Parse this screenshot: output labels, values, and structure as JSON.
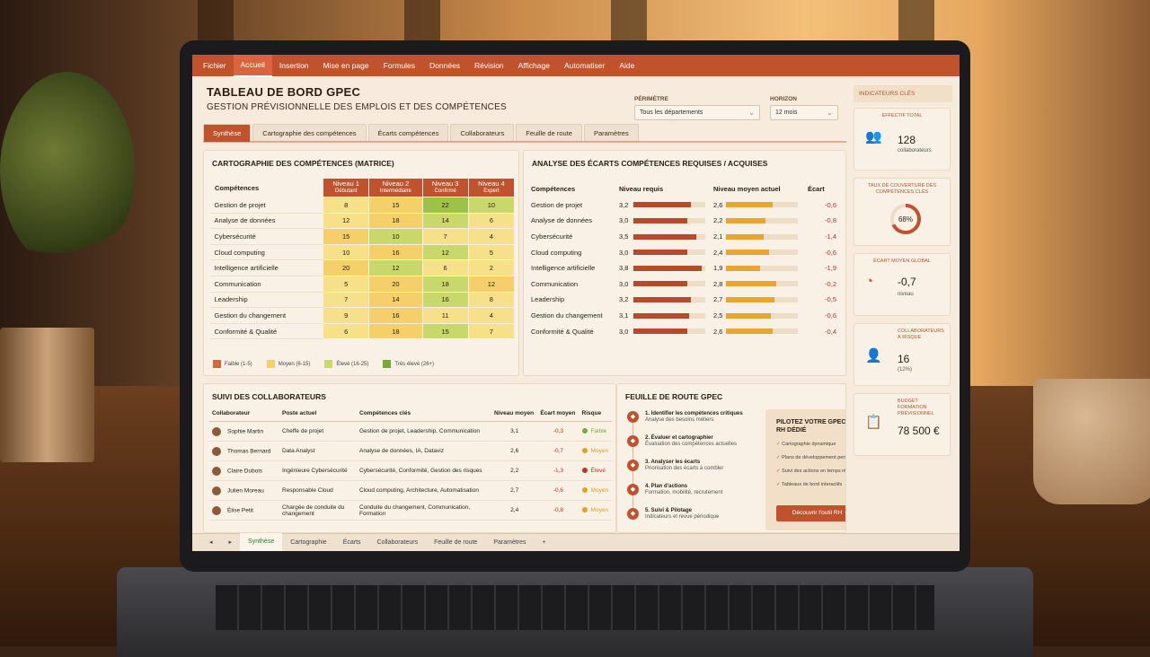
{
  "ribbon": [
    "Fichier",
    "Accueil",
    "Insertion",
    "Mise en page",
    "Formules",
    "Données",
    "Révision",
    "Affichage",
    "Automatiser",
    "Aide"
  ],
  "header": {
    "title": "TABLEAU DE BORD GPEC",
    "subtitle": "GESTION PRÉVISIONNELLE DES EMPLOIS ET DES COMPÉTENCES"
  },
  "filters": {
    "perimetre_label": "PÉRIMÈTRE",
    "perimetre_value": "Tous les départements",
    "horizon_label": "HORIZON",
    "horizon_value": "12 mois"
  },
  "tabs": [
    "Synthèse",
    "Cartographie des compétences",
    "Écarts compétences",
    "Collaborateurs",
    "Feuille de route",
    "Paramètres"
  ],
  "matrix": {
    "title": "CARTOGRAPHIE DES COMPÉTENCES (MATRICE)",
    "col0": "Compétences",
    "levels": [
      {
        "name": "Niveau 1",
        "sub": "Débutant"
      },
      {
        "name": "Niveau 2",
        "sub": "Intermédiaire"
      },
      {
        "name": "Niveau 3",
        "sub": "Confirmé"
      },
      {
        "name": "Niveau 4",
        "sub": "Expert"
      }
    ],
    "rows": [
      {
        "label": "Gestion de projet",
        "v": [
          "8",
          "15",
          "22",
          "10"
        ]
      },
      {
        "label": "Analyse de données",
        "v": [
          "12",
          "18",
          "14",
          "6"
        ]
      },
      {
        "label": "Cybersécurité",
        "v": [
          "15",
          "10",
          "7",
          "4"
        ]
      },
      {
        "label": "Cloud computing",
        "v": [
          "10",
          "16",
          "12",
          "5"
        ]
      },
      {
        "label": "Intelligence artificielle",
        "v": [
          "20",
          "12",
          "6",
          "2"
        ]
      },
      {
        "label": "Communication",
        "v": [
          "5",
          "20",
          "18",
          "12"
        ]
      },
      {
        "label": "Leadership",
        "v": [
          "7",
          "14",
          "16",
          "8"
        ]
      },
      {
        "label": "Gestion du changement",
        "v": [
          "9",
          "16",
          "11",
          "4"
        ]
      },
      {
        "label": "Conformité & Qualité",
        "v": [
          "6",
          "18",
          "15",
          "7"
        ]
      }
    ],
    "cell_colors": [
      [
        "#f7e08a",
        "#f4cf6a",
        "#9cc24a",
        "#c9d86a"
      ],
      [
        "#f7e08a",
        "#f4cf6a",
        "#c9d86a",
        "#f7e08a"
      ],
      [
        "#f4cf6a",
        "#c9d86a",
        "#f7e08a",
        "#f7e08a"
      ],
      [
        "#f7e08a",
        "#f4cf6a",
        "#c9d86a",
        "#f7e08a"
      ],
      [
        "#f4cf6a",
        "#c9d86a",
        "#f7e08a",
        "#f7e08a"
      ],
      [
        "#f7e08a",
        "#f4cf6a",
        "#c9d86a",
        "#f4cf6a"
      ],
      [
        "#f7e08a",
        "#f4cf6a",
        "#c9d86a",
        "#f7e08a"
      ],
      [
        "#f7e08a",
        "#f4cf6a",
        "#f7e08a",
        "#f7e08a"
      ],
      [
        "#f7e08a",
        "#f4cf6a",
        "#c9d86a",
        "#f7e08a"
      ]
    ],
    "legend": [
      {
        "label": "Faible (1-5)",
        "color": "#d9643e"
      },
      {
        "label": "Moyen (6-15)",
        "color": "#f4cf6a"
      },
      {
        "label": "Élevé (16-25)",
        "color": "#c9d86a"
      },
      {
        "label": "Très élevé (26+)",
        "color": "#7aa83a"
      }
    ]
  },
  "gaps": {
    "title": "ANALYSE DES ÉCARTS COMPÉTENCES REQUISES / ACQUISES",
    "h_comp": "Compétences",
    "h_req": "Niveau requis",
    "h_act": "Niveau moyen actuel",
    "h_gap": "Écart",
    "scale_max": 4,
    "rows": [
      {
        "label": "Gestion de projet",
        "req": "3,2",
        "req_n": 3.2,
        "act": "2,6",
        "act_n": 2.6,
        "gap": "-0,6"
      },
      {
        "label": "Analyse de données",
        "req": "3,0",
        "req_n": 3.0,
        "act": "2,2",
        "act_n": 2.2,
        "gap": "-0,8"
      },
      {
        "label": "Cybersécurité",
        "req": "3,5",
        "req_n": 3.5,
        "act": "2,1",
        "act_n": 2.1,
        "gap": "-1,4"
      },
      {
        "label": "Cloud computing",
        "req": "3,0",
        "req_n": 3.0,
        "act": "2,4",
        "act_n": 2.4,
        "gap": "-0,6"
      },
      {
        "label": "Intelligence artificielle",
        "req": "3,8",
        "req_n": 3.8,
        "act": "1,9",
        "act_n": 1.9,
        "gap": "-1,9"
      },
      {
        "label": "Communication",
        "req": "3,0",
        "req_n": 3.0,
        "act": "2,8",
        "act_n": 2.8,
        "gap": "-0,2"
      },
      {
        "label": "Leadership",
        "req": "3,2",
        "req_n": 3.2,
        "act": "2,7",
        "act_n": 2.7,
        "gap": "-0,5"
      },
      {
        "label": "Gestion du changement",
        "req": "3,1",
        "req_n": 3.1,
        "act": "2,5",
        "act_n": 2.5,
        "gap": "-0,6"
      },
      {
        "label": "Conformité & Qualité",
        "req": "3,0",
        "req_n": 3.0,
        "act": "2,6",
        "act_n": 2.6,
        "gap": "-0,4"
      }
    ]
  },
  "collab": {
    "title": "SUIVI DES COLLABORATEURS",
    "headers": [
      "Collaborateur",
      "Poste actuel",
      "Compétences clés",
      "Niveau moyen",
      "Écart moyen",
      "Risque"
    ],
    "rows": [
      {
        "name": "Sophie Martin",
        "poste": "Cheffe de projet",
        "comp": "Gestion de projet, Leadership, Communication",
        "niv": "3,1",
        "ecart": "-0,3",
        "risque": "Faible",
        "color": "#7aa83a"
      },
      {
        "name": "Thomas Bernard",
        "poste": "Data Analyst",
        "comp": "Analyse de données, IA, Dataviz",
        "niv": "2,6",
        "ecart": "-0,7",
        "risque": "Moyen",
        "color": "#e0a020"
      },
      {
        "name": "Claire Dubois",
        "poste": "Ingénieure Cybersécurité",
        "comp": "Cybersécurité, Conformité, Gestion des risques",
        "niv": "2,2",
        "ecart": "-1,3",
        "risque": "Élevé",
        "color": "#c0302e"
      },
      {
        "name": "Julien Moreau",
        "poste": "Responsable Cloud",
        "comp": "Cloud computing, Architecture, Automatisation",
        "niv": "2,7",
        "ecart": "-0,6",
        "risque": "Moyen",
        "color": "#e0a020"
      },
      {
        "name": "Élise Petit",
        "poste": "Chargée de conduite du changement",
        "comp": "Conduite du changement, Communication, Formation",
        "niv": "2,4",
        "ecart": "-0,8",
        "risque": "Moyen",
        "color": "#e0a020"
      }
    ]
  },
  "roadmap": {
    "title": "FEUILLE DE ROUTE GPEC",
    "steps": [
      {
        "title": "1. Identifier les compétences critiques",
        "sub": "Analyse des besoins métiers"
      },
      {
        "title": "2. Évaluer et cartographier",
        "sub": "Évaluation des compétences actuelles"
      },
      {
        "title": "3. Analyser les écarts",
        "sub": "Priorisation des écarts à combler"
      },
      {
        "title": "4. Plan d'actions",
        "sub": "Formation, mobilité, recrutement"
      },
      {
        "title": "5. Suivi & Pilotage",
        "sub": "Indicateurs et revue périodique"
      }
    ],
    "promo": {
      "title": "PILOTEZ VOTRE GPEC AVEC UN OUTIL RH DÉDIÉ",
      "items": [
        "Cartographie dynamique",
        "Plans de développement personnalisés",
        "Suivi des actions en temps réel",
        "Tableaux de bord interactifs"
      ],
      "button": "Découvrir l'outil RH"
    }
  },
  "kpis": {
    "title": "INDICATEURS CLÉS",
    "effectif": {
      "label": "EFFECTIF TOTAL",
      "value": "128",
      "sub": "collaborateurs"
    },
    "couverture": {
      "label": "TAUX DE COUVERTURE DES COMPÉTENCES CLÉS",
      "value": "68%",
      "pct": 68
    },
    "ecart": {
      "label": "ÉCART MOYEN GLOBAL",
      "value": "-0,7",
      "sub": "niveau"
    },
    "risque": {
      "label": "COLLABORATEURS À RISQUE",
      "value": "16",
      "sub": "(12%)"
    },
    "budget": {
      "label": "BUDGET FORMATION PRÉVISIONNEL",
      "value": "78 500 €"
    }
  },
  "sheets": [
    "Synthèse",
    "Cartographie",
    "Écarts",
    "Collaborateurs",
    "Feuille de route",
    "Paramètres"
  ],
  "sheet_add": "+",
  "colors": {
    "accent": "#c0532e",
    "req_bar": "#b8492a",
    "act_bar": "#e8a630"
  }
}
